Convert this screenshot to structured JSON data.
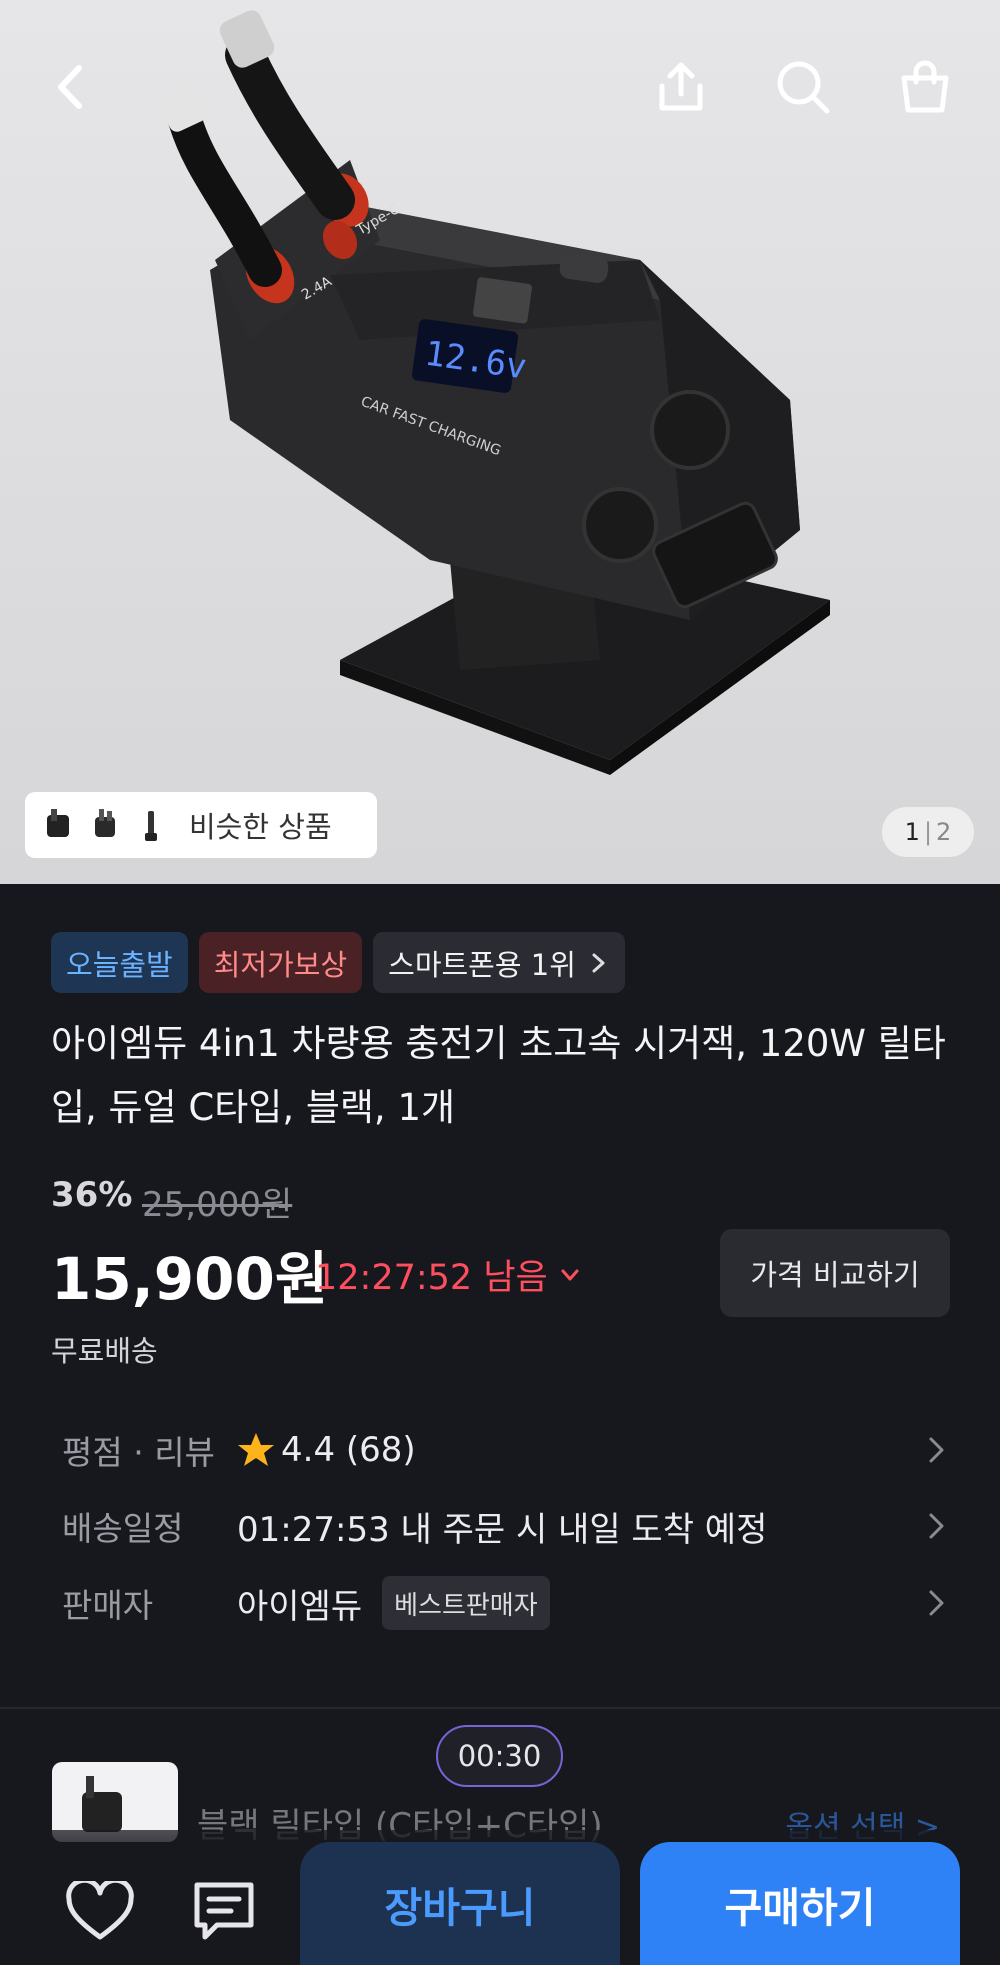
{
  "header": {
    "back_icon": "chevron-left-icon",
    "share_icon": "share-icon",
    "search_icon": "search-icon",
    "bag_icon": "shopping-bag-icon"
  },
  "gallery": {
    "similar_label": "비슷한 상품",
    "current_page": "1",
    "total_pages": "2",
    "product_print_type_c": "Type-C",
    "product_print_amp": "2.4A",
    "product_print_voltage": "12.6v",
    "product_print_brand": "CAR FAST CHARGING"
  },
  "badges": {
    "today_ship": "오늘출발",
    "lowest_price": "최저가보상",
    "rank": "스마트폰용 1위"
  },
  "product": {
    "title": "아이엠듀 4in1 차량용 충전기 초고속 시거잭, 120W 릴타입, 듀얼 C타입, 블랙, 1개",
    "discount": "36%",
    "original_price": "25,000원",
    "price": "15,900원",
    "timer_text": "12:27:52 남음",
    "compare_label": "가격 비교하기",
    "shipping": "무료배송"
  },
  "details": {
    "rating_key": "평점 · 리뷰",
    "rating_value": "4.4 (68)",
    "delivery_key": "배송일정",
    "delivery_value": "01:27:53 내 주문 시 내일 도착 예정",
    "seller_key": "판매자",
    "seller_value": "아이엠듀",
    "seller_badge": "베스트판매자"
  },
  "option": {
    "name": "블랙 릴타입 (C타입+C타입)",
    "select_label": "옵션 선택 >",
    "countdown": "00:30"
  },
  "bottom_bar": {
    "cart_label": "장바구니",
    "buy_label": "구매하기"
  },
  "colors": {
    "accent_blue": "#2f82f5",
    "timer_red": "#ff4f5e",
    "star": "#ffb31a"
  }
}
